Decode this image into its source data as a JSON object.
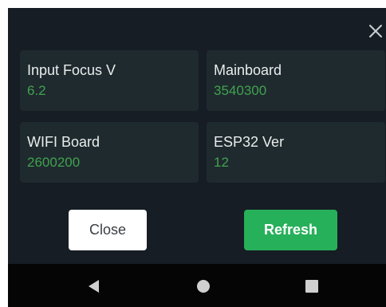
{
  "dialog": {
    "cards": [
      {
        "label": "Input Focus V",
        "value": "6.2"
      },
      {
        "label": "Mainboard",
        "value": "3540300"
      },
      {
        "label": "WIFI Board",
        "value": "2600200"
      },
      {
        "label": "ESP32 Ver",
        "value": "12"
      }
    ],
    "buttons": {
      "close_label": "Close",
      "refresh_label": "Refresh"
    },
    "icons": {
      "dismiss": "close-icon"
    }
  },
  "navbar": {
    "icons": [
      "back-triangle-icon",
      "home-circle-icon",
      "recents-square-icon"
    ]
  },
  "colors": {
    "background": "#161d24",
    "card": "#1f2a2f",
    "value_text": "#3fa34d",
    "refresh_button": "#27b05a",
    "navbar": "#050505"
  }
}
